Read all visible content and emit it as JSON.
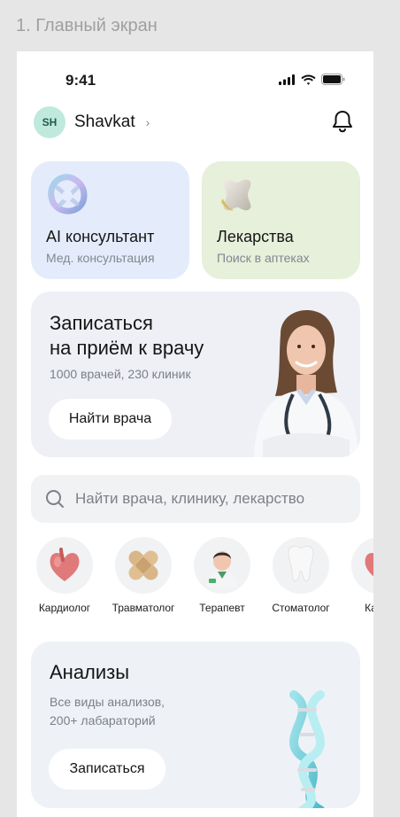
{
  "frame_title": "1. Главный экран",
  "status_bar": {
    "time": "9:41"
  },
  "header": {
    "avatar_initials": "SH",
    "user_name": "Shavkat",
    "chevron": "›"
  },
  "cards": {
    "ai": {
      "title": "AI консультант",
      "subtitle": "Мед. консультация"
    },
    "medicines": {
      "title": "Лекарства",
      "subtitle": "Поиск в аптеках"
    }
  },
  "booking": {
    "title_line1": "Записаться",
    "title_line2": "на приём к врачу",
    "subtitle": "1000 врачей, 230 клиник",
    "button": "Найти врача"
  },
  "search": {
    "placeholder": "Найти врача, клинику, лекарство"
  },
  "specialties": [
    {
      "label": "Кардиолог",
      "icon": "heart-icon"
    },
    {
      "label": "Травматолог",
      "icon": "bandage-icon"
    },
    {
      "label": "Терапевт",
      "icon": "doctor-icon"
    },
    {
      "label": "Стоматолог",
      "icon": "tooth-icon"
    },
    {
      "label": "Карди",
      "icon": "heart-icon"
    }
  ],
  "analyses": {
    "title": "Анализы",
    "subtitle_line1": "Все виды анализов,",
    "subtitle_line2": "200+ лабараторий",
    "button": "Записаться"
  },
  "colors": {
    "ai_card": "#e4ecfc",
    "med_card": "#e6f0da",
    "booking_card": "#eef0f5",
    "analyses_card": "#eef2f7",
    "avatar": "#bfe9dc"
  }
}
